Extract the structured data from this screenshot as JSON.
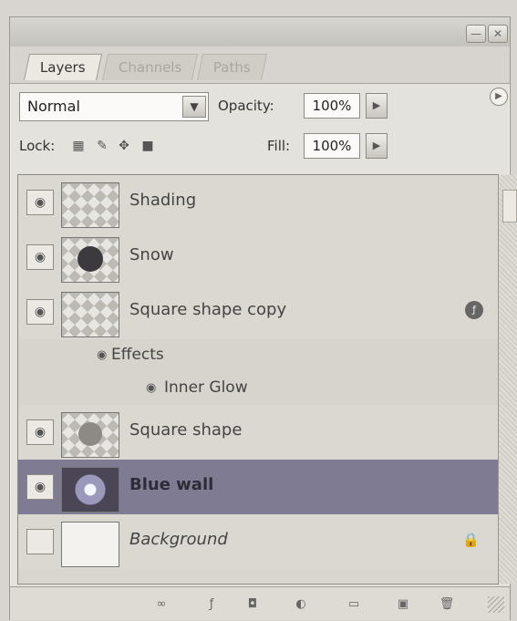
{
  "panel": {
    "tabs": [
      "Layers",
      "Channels",
      "Paths"
    ],
    "blend_mode": "Normal",
    "opacity_label": "Opacity:",
    "opacity_value": "100%",
    "lock_label": "Lock:",
    "fill_label": "Fill:",
    "fill_value": "100%"
  },
  "layers": [
    {
      "name": "Shading"
    },
    {
      "name": "Snow"
    },
    {
      "name": "Square shape copy"
    },
    {
      "name": "Effects"
    },
    {
      "name": "Inner Glow"
    },
    {
      "name": "Square shape"
    },
    {
      "name": "Blue wall"
    },
    {
      "name": "Background"
    }
  ]
}
